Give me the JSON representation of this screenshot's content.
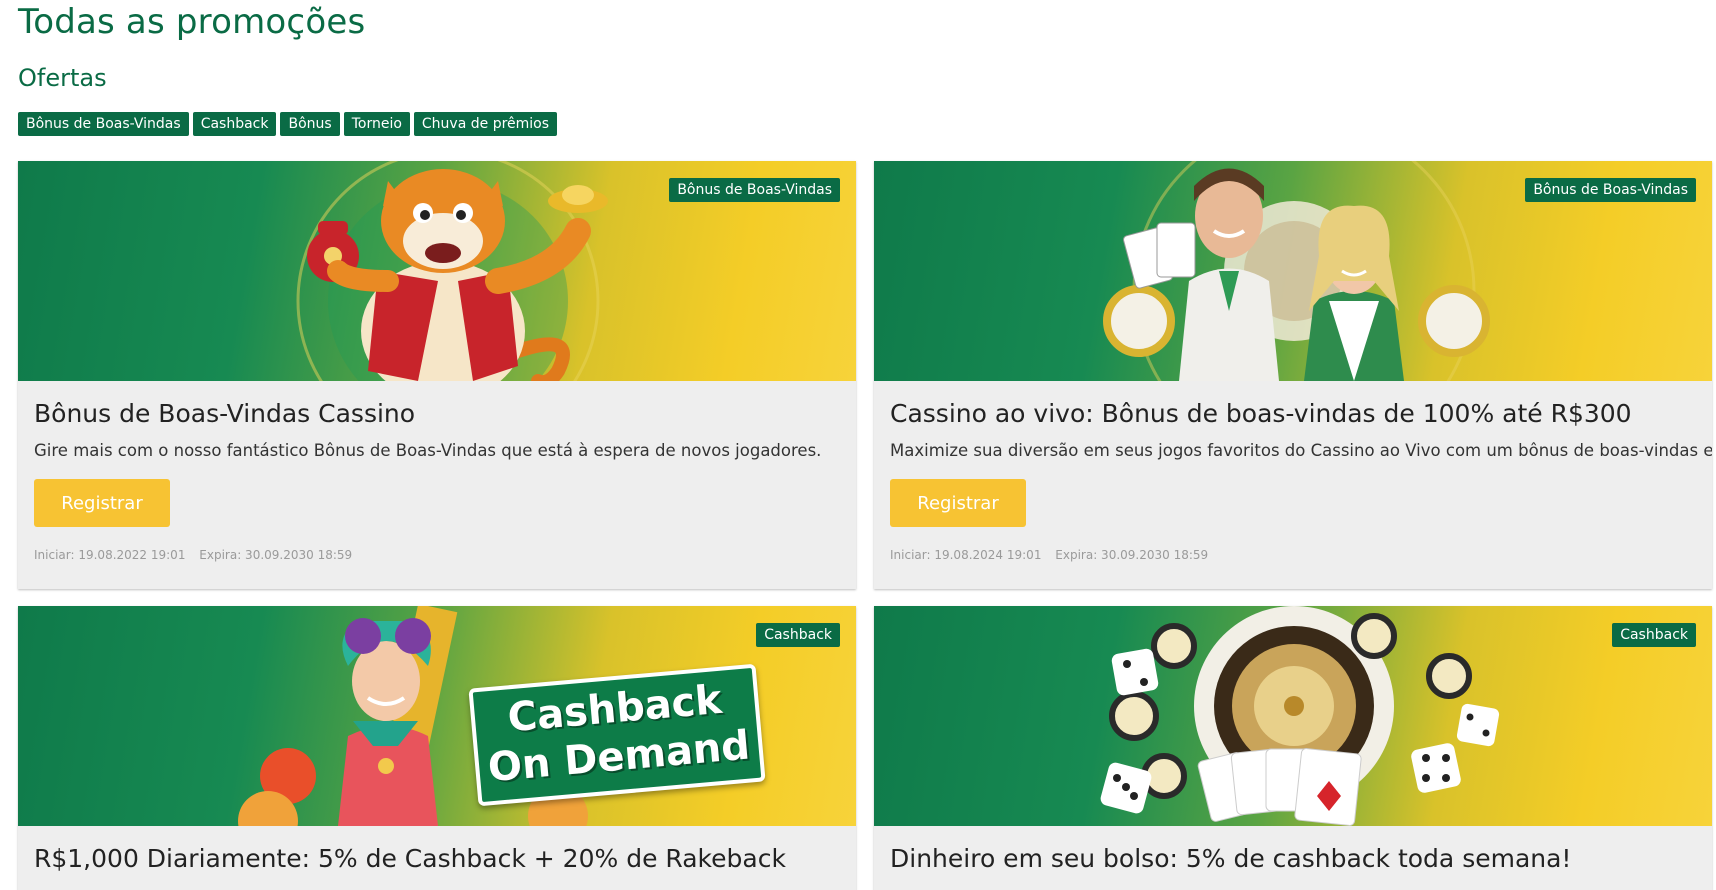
{
  "page": {
    "title": "Todas as promoções",
    "section_title": "Ofertas"
  },
  "filters": [
    {
      "label": "Bônus de Boas-Vindas"
    },
    {
      "label": "Cashback"
    },
    {
      "label": "Bônus"
    },
    {
      "label": "Torneio"
    },
    {
      "label": "Chuva de prêmios"
    }
  ],
  "promotions": [
    {
      "badge": "Bônus de Boas-Vindas",
      "title": "Bônus de Boas-Vindas Cassino",
      "description": "Gire mais com o nosso fantástico Bônus de Boas-Vindas que está à espera de novos jogadores.",
      "button": "Registrar",
      "start": "Iniciar: 19.08.2022 19:01",
      "expires": "Expira: 30.09.2030 18:59",
      "image": "tiger-mascot-illustration"
    },
    {
      "badge": "Bônus de Boas-Vindas",
      "title": "Cassino ao vivo: Bônus de boas-vindas de 100% até R$300",
      "description": "Maximize sua diversão em seus jogos favoritos do Cassino ao Vivo com um bônus de boas-vindas exclusivo.",
      "button": "Registrar",
      "start": "Iniciar: 19.08.2024 19:01",
      "expires": "Expira: 30.09.2030 18:59",
      "image": "live-dealers-illustration"
    },
    {
      "badge": "Cashback",
      "title": "R$1,000 Diariamente: 5% de Cashback + 20% de Rakeback",
      "image": "cashback-on-demand-illustration",
      "image_text": [
        "Cashback",
        "On Demand"
      ]
    },
    {
      "badge": "Cashback",
      "title": "Dinheiro em seu bolso: 5% de cashback toda semana!",
      "image": "roulette-dice-chips-illustration"
    }
  ],
  "colors": {
    "brand_green": "#0a6b45",
    "button_yellow": "#f7c333",
    "card_bg": "#eeeeee"
  }
}
